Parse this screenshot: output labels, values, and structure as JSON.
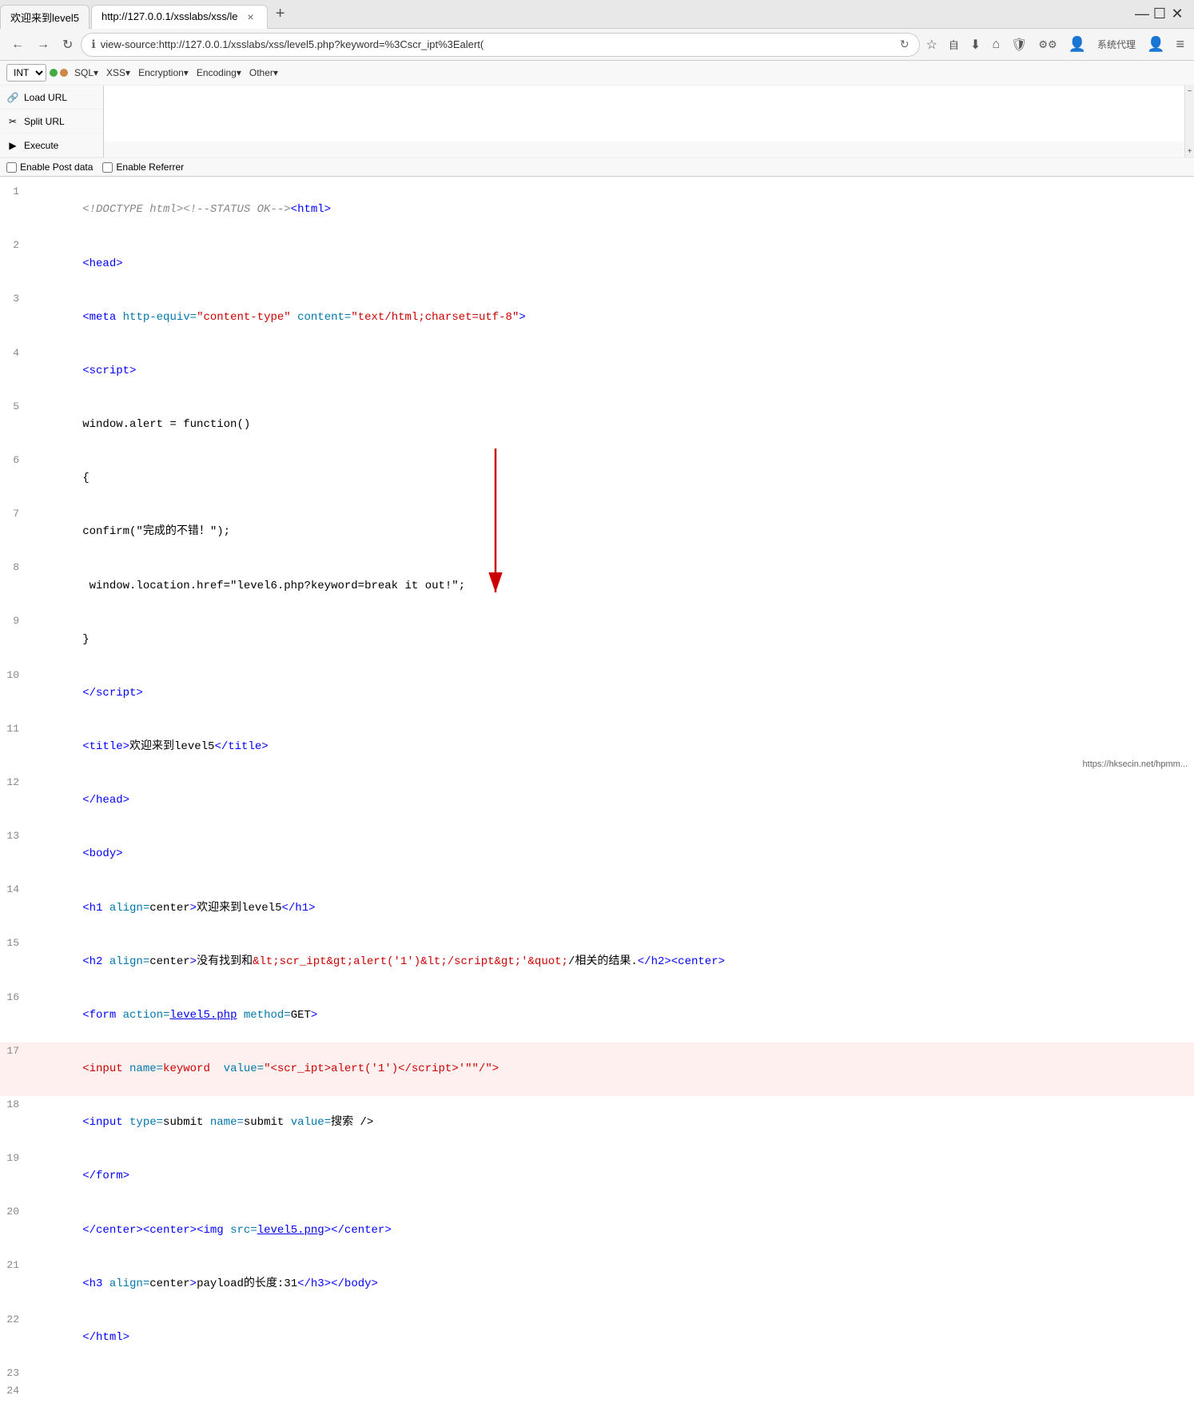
{
  "titlebar": {
    "tab1_label": "欢迎来到level5",
    "tab2_label": "http://127.0.0.1/xsslabs/xss/le",
    "tab2_close": "×",
    "tab_new": "+",
    "win_min": "—",
    "win_max": "☐",
    "win_close": "✕"
  },
  "navbar": {
    "back": "←",
    "forward": "→",
    "address": "view-source:http://127.0.0.1/xsslabs/xss/level5.php?keyword=%3Cscr_ipt%3Ealert(",
    "refresh": "↻",
    "bookmark_star": "☆",
    "reader": "自",
    "download": "⬇",
    "home": "⌂",
    "shield": "🛡",
    "tools": "⚙",
    "profile": "👤",
    "proxy": "系统代理",
    "avatar": "👤",
    "menu": "≡"
  },
  "hackbar": {
    "select_value": "INT",
    "dot1": "green",
    "dot2": "orange",
    "menus": [
      "SQL▾",
      "XSS▾",
      "Encryption▾",
      "Encoding▾",
      "Other▾"
    ],
    "load_url": "Load URL",
    "split_url": "Split URL",
    "execute": "Execute",
    "textarea_placeholder": "",
    "scroll_up": "−",
    "scroll_down": "+",
    "enable_post": "Enable Post data",
    "enable_referrer": "Enable Referrer"
  },
  "source": {
    "lines": [
      {
        "num": 1,
        "html": "doctype_line"
      },
      {
        "num": 2,
        "html": "head_open"
      },
      {
        "num": 3,
        "html": "meta_line"
      },
      {
        "num": 4,
        "html": "script_open"
      },
      {
        "num": 5,
        "html": "window_alert"
      },
      {
        "num": 6,
        "html": "brace_open"
      },
      {
        "num": 7,
        "html": "confirm_line"
      },
      {
        "num": 8,
        "html": "window_location"
      },
      {
        "num": 9,
        "html": "brace_close"
      },
      {
        "num": 10,
        "html": "script_close"
      },
      {
        "num": 11,
        "html": "title_line"
      },
      {
        "num": 12,
        "html": "head_close"
      },
      {
        "num": 13,
        "html": "body_open"
      },
      {
        "num": 14,
        "html": "h1_line"
      },
      {
        "num": 15,
        "html": "h2_line"
      },
      {
        "num": 16,
        "html": "form_line"
      },
      {
        "num": 17,
        "html": "input_keyword"
      },
      {
        "num": 18,
        "html": "input_submit"
      },
      {
        "num": 19,
        "html": "form_close"
      },
      {
        "num": 20,
        "html": "center_img"
      },
      {
        "num": 21,
        "html": "h3_line"
      },
      {
        "num": 22,
        "html": "html_close"
      },
      {
        "num": 23,
        "html": "empty"
      },
      {
        "num": 24,
        "html": "empty"
      }
    ]
  },
  "statusbar": {
    "text": "https://hksecin.net/hpmm..."
  }
}
